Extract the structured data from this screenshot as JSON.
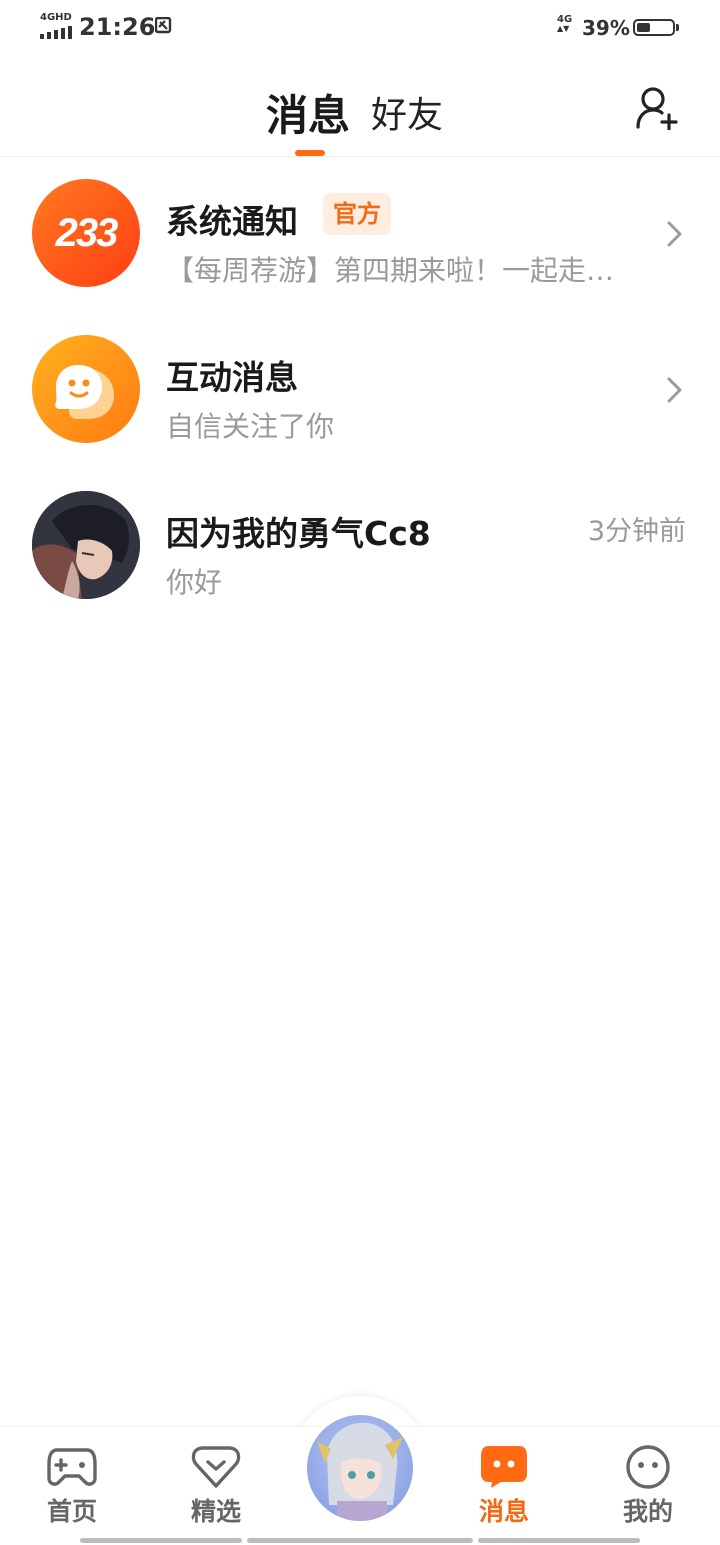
{
  "status_bar": {
    "network_left": "4GHD",
    "time": "21:26",
    "network_right": "4G",
    "battery_text": "39%",
    "battery_level": 0.39
  },
  "header": {
    "tab_active": "消息",
    "tab_inactive": "好友"
  },
  "messages": [
    {
      "title": "系统通知",
      "badge": "官方",
      "preview": "【每周荐游】第四期来啦！一起走…",
      "avatar_text": "233",
      "avatar_color": "#ff5a1f"
    },
    {
      "title": "互动消息",
      "preview": "自信关注了你",
      "avatar_color": "#ffa21a"
    },
    {
      "title": "因为我的勇气Cc8",
      "preview": "你好",
      "time": "3分钟前"
    }
  ],
  "bottom_nav": {
    "items": [
      {
        "label": "首页",
        "icon": "gamepad-icon"
      },
      {
        "label": "精选",
        "icon": "heart-check-icon"
      },
      {
        "label": "消息",
        "icon": "chat-bubble-icon",
        "active": true
      },
      {
        "label": "我的",
        "icon": "face-icon"
      }
    ]
  },
  "colors": {
    "accent": "#f26a13",
    "text_primary": "#1a1a1a",
    "text_secondary": "#9a9a9a"
  }
}
